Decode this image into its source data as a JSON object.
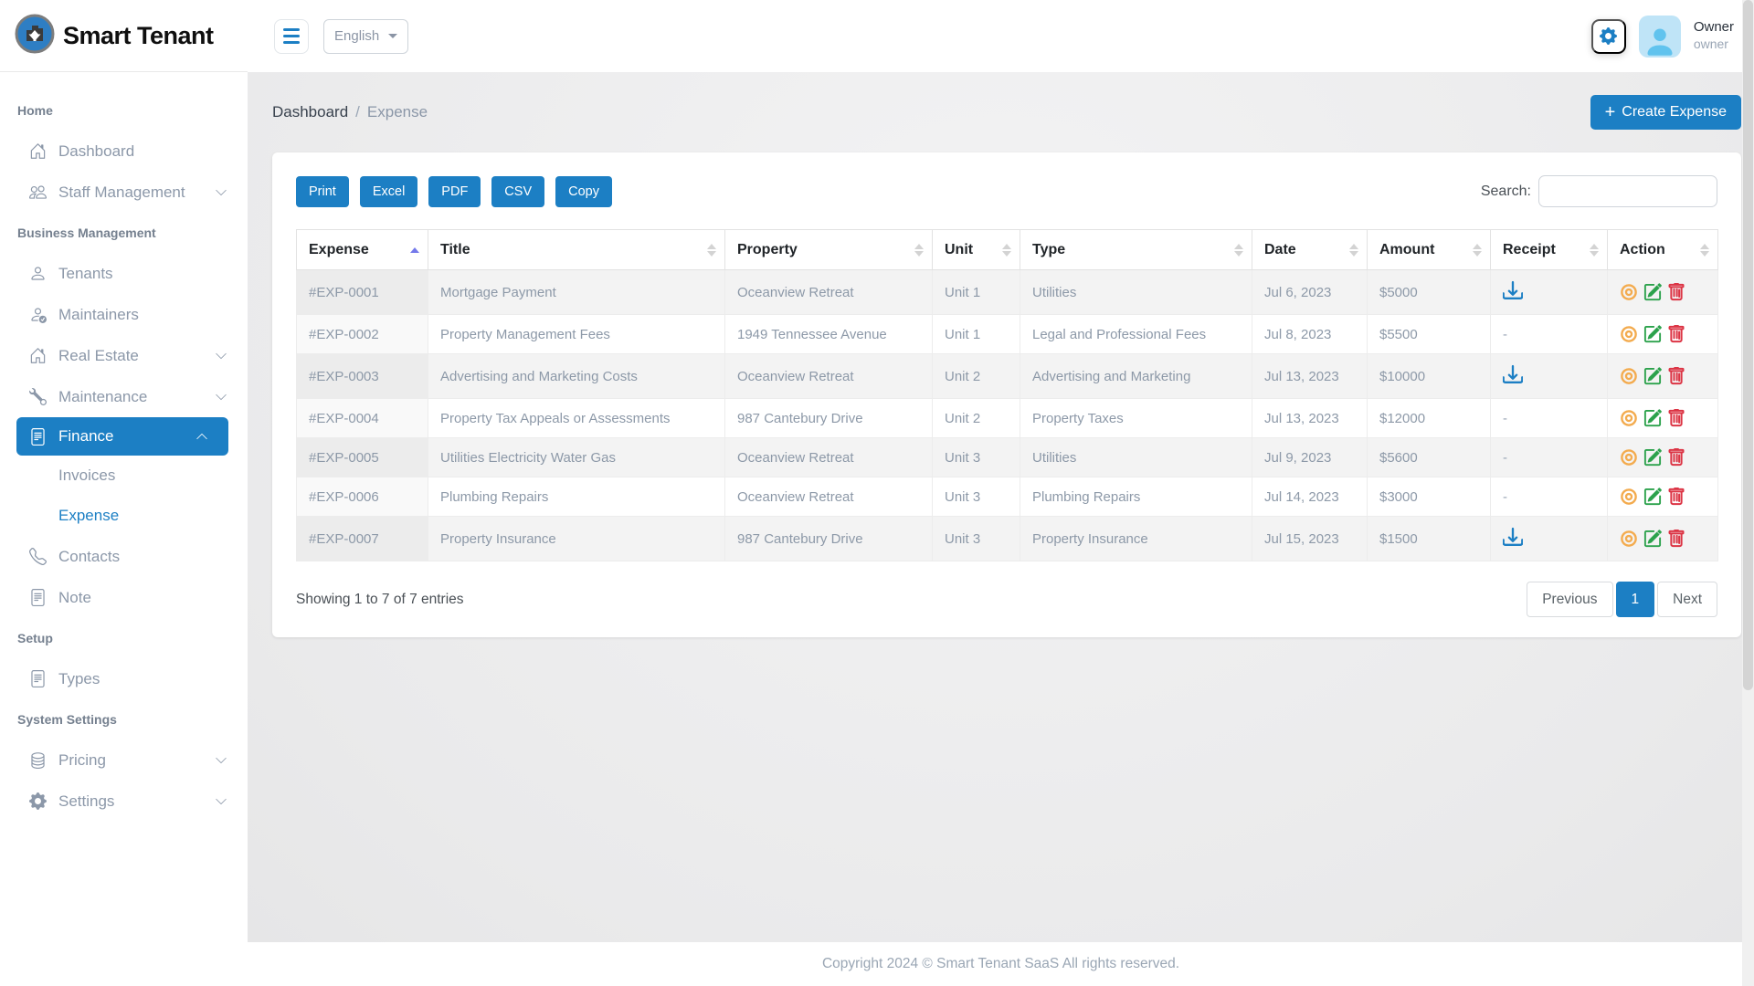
{
  "colors": {
    "accent": "#1c7fc4",
    "view_icon": "#f3ab4e",
    "edit_icon": "#2ca24c",
    "delete_icon": "#dc3545",
    "sort_active": "#7479ea"
  },
  "brand": {
    "name": "Smart Tenant"
  },
  "topbar": {
    "language": "English",
    "user": {
      "name": "Owner",
      "role": "owner"
    }
  },
  "breadcrumb": {
    "parent": "Dashboard",
    "separator": "/",
    "current": "Expense"
  },
  "create_button": {
    "label": "Create Expense"
  },
  "sidebar": {
    "sections": [
      {
        "header": "Home",
        "items": [
          {
            "label": "Dashboard",
            "icon": "home"
          },
          {
            "label": "Staff Management",
            "icon": "people",
            "chevron": true
          }
        ]
      },
      {
        "header": "Business Management",
        "items": [
          {
            "label": "Tenants",
            "icon": "person"
          },
          {
            "label": "Maintainers",
            "icon": "person-check"
          },
          {
            "label": "Real Estate",
            "icon": "home",
            "chevron": true
          },
          {
            "label": "Maintenance",
            "icon": "wrench",
            "chevron": true
          },
          {
            "label": "Finance",
            "icon": "file-text",
            "chevron": true,
            "active": true,
            "children": [
              {
                "label": "Invoices"
              },
              {
                "label": "Expense",
                "active": true
              }
            ]
          },
          {
            "label": "Contacts",
            "icon": "phone"
          },
          {
            "label": "Note",
            "icon": "file-text"
          }
        ]
      },
      {
        "header": "Setup",
        "items": [
          {
            "label": "Types",
            "icon": "file-text"
          }
        ]
      },
      {
        "header": "System Settings",
        "items": [
          {
            "label": "Pricing",
            "icon": "database",
            "chevron": true
          },
          {
            "label": "Settings",
            "icon": "gear",
            "chevron": true
          }
        ]
      }
    ]
  },
  "toolbar": {
    "export_buttons": [
      "Print",
      "Excel",
      "PDF",
      "CSV",
      "Copy"
    ],
    "search_label": "Search:",
    "search_value": ""
  },
  "table": {
    "columns": [
      {
        "label": "Expense",
        "sort": "asc"
      },
      {
        "label": "Title"
      },
      {
        "label": "Property"
      },
      {
        "label": "Unit"
      },
      {
        "label": "Type"
      },
      {
        "label": "Date"
      },
      {
        "label": "Amount"
      },
      {
        "label": "Receipt"
      },
      {
        "label": "Action"
      }
    ],
    "rows": [
      {
        "expense": "#EXP-0001",
        "title": "Mortgage Payment",
        "property": "Oceanview Retreat",
        "unit": "Unit 1",
        "type": "Utilities",
        "date": "Jul 6, 2023",
        "amount": "$5000",
        "receipt": true
      },
      {
        "expense": "#EXP-0002",
        "title": "Property Management Fees",
        "property": "1949 Tennessee Avenue",
        "unit": "Unit 1",
        "type": "Legal and Professional Fees",
        "date": "Jul 8, 2023",
        "amount": "$5500",
        "receipt": false
      },
      {
        "expense": "#EXP-0003",
        "title": "Advertising and Marketing Costs",
        "property": "Oceanview Retreat",
        "unit": "Unit 2",
        "type": "Advertising and Marketing",
        "date": "Jul 13, 2023",
        "amount": "$10000",
        "receipt": true
      },
      {
        "expense": "#EXP-0004",
        "title": "Property Tax Appeals or Assessments",
        "property": "987 Cantebury Drive",
        "unit": "Unit 2",
        "type": "Property Taxes",
        "date": "Jul 13, 2023",
        "amount": "$12000",
        "receipt": false
      },
      {
        "expense": "#EXP-0005",
        "title": "Utilities Electricity Water Gas",
        "property": "Oceanview Retreat",
        "unit": "Unit 3",
        "type": "Utilities",
        "date": "Jul 9, 2023",
        "amount": "$5600",
        "receipt": false
      },
      {
        "expense": "#EXP-0006",
        "title": "Plumbing Repairs",
        "property": "Oceanview Retreat",
        "unit": "Unit 3",
        "type": "Plumbing Repairs",
        "date": "Jul 14, 2023",
        "amount": "$3000",
        "receipt": false
      },
      {
        "expense": "#EXP-0007",
        "title": "Property Insurance",
        "property": "987 Cantebury Drive",
        "unit": "Unit 3",
        "type": "Property Insurance",
        "date": "Jul 15, 2023",
        "amount": "$1500",
        "receipt": true
      }
    ],
    "no_receipt_placeholder": "-",
    "summary": "Showing 1 to 7 of 7 entries"
  },
  "pagination": {
    "previous": "Previous",
    "current_page": "1",
    "next": "Next"
  },
  "footer": {
    "copyright": "Copyright 2024 © Smart Tenant SaaS All rights reserved."
  }
}
